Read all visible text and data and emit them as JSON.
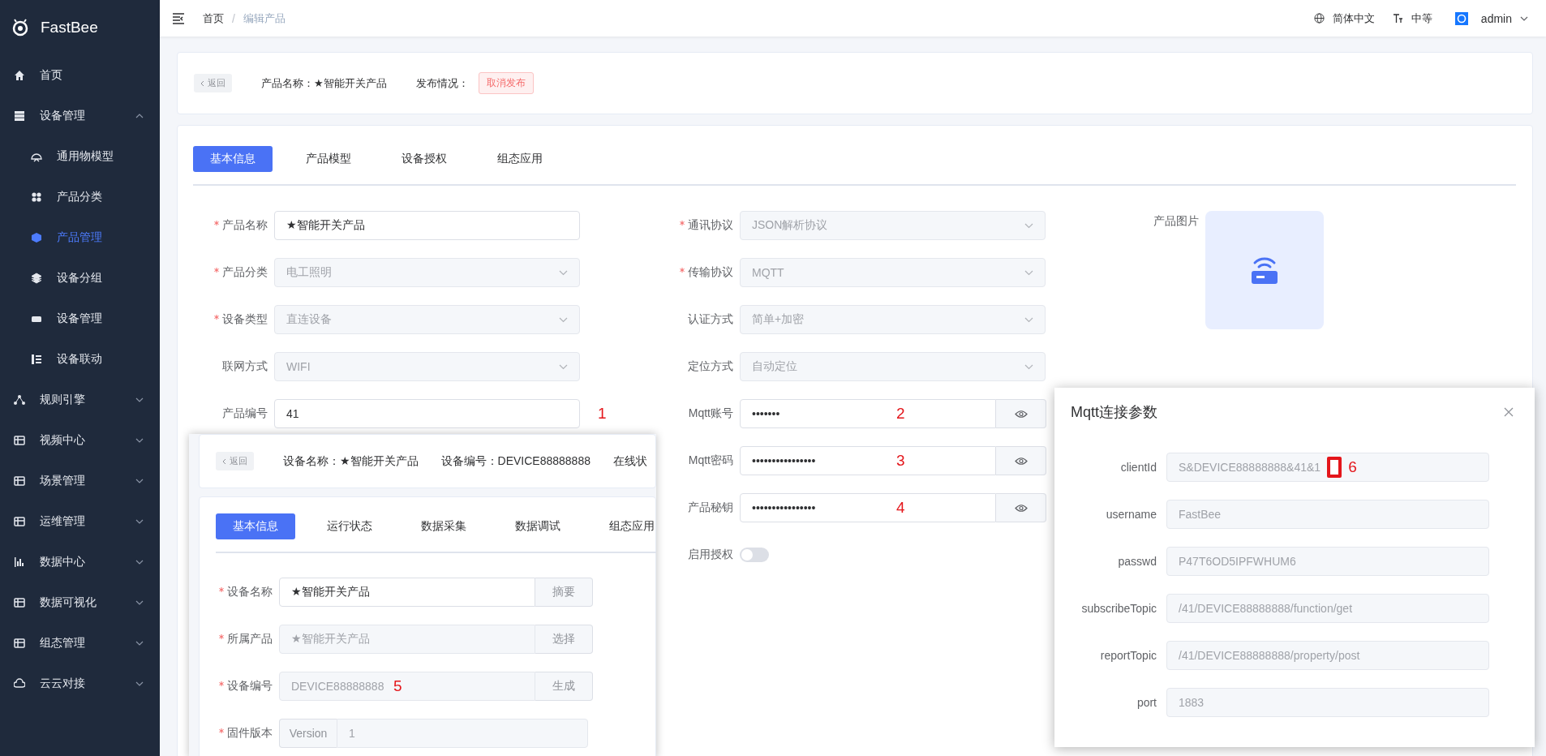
{
  "sidebar": {
    "brand": "FastBee",
    "items": [
      {
        "kind": "link",
        "label": "首页",
        "selected": false
      },
      {
        "kind": "group",
        "label": "设备管理",
        "expanded": true,
        "children": [
          {
            "label": "通用物模型",
            "selected": false
          },
          {
            "label": "产品分类",
            "selected": false
          },
          {
            "label": "产品管理",
            "selected": true
          },
          {
            "label": "设备分组",
            "selected": false
          },
          {
            "label": "设备管理",
            "selected": false
          },
          {
            "label": "设备联动",
            "selected": false
          }
        ]
      },
      {
        "kind": "group",
        "label": "规则引擎",
        "expanded": false
      },
      {
        "kind": "group",
        "label": "视频中心",
        "expanded": false
      },
      {
        "kind": "group",
        "label": "场景管理",
        "expanded": false
      },
      {
        "kind": "group",
        "label": "运维管理",
        "expanded": false
      },
      {
        "kind": "group",
        "label": "数据中心",
        "expanded": false
      },
      {
        "kind": "group",
        "label": "数据可视化",
        "expanded": false
      },
      {
        "kind": "group",
        "label": "组态管理",
        "expanded": false
      },
      {
        "kind": "group",
        "label": "云云对接",
        "expanded": false
      }
    ]
  },
  "header": {
    "breadcrumb": [
      "首页",
      "编辑产品"
    ],
    "separator": "/",
    "language": "简体中文",
    "size": "中等",
    "user": "admin"
  },
  "product_bar": {
    "back": "返回",
    "name": "产品名称：★智能开关产品",
    "status_label": "发布情况：",
    "status_tag": "取消发布"
  },
  "tabs": [
    {
      "label": "基本信息",
      "selected": true
    },
    {
      "label": "产品模型",
      "selected": false
    },
    {
      "label": "设备授权",
      "selected": false
    },
    {
      "label": "组态应用",
      "selected": false
    }
  ],
  "form": {
    "columns": [
      [
        {
          "kind": "input",
          "label": "产品名称",
          "required": true,
          "disabled": false,
          "value": "★智能开关产品"
        },
        {
          "kind": "select",
          "label": "产品分类",
          "required": true,
          "disabled": true,
          "value": "电工照明"
        },
        {
          "kind": "select",
          "label": "设备类型",
          "required": true,
          "disabled": true,
          "value": "直连设备"
        },
        {
          "kind": "select",
          "label": "联网方式",
          "required": false,
          "disabled": true,
          "value": "WIFI"
        },
        {
          "kind": "input",
          "label": "产品编号",
          "required": false,
          "disabled": false,
          "value": "41",
          "annotation": "1"
        }
      ],
      [
        {
          "kind": "select",
          "label": "通讯协议",
          "required": true,
          "disabled": true,
          "value": "JSON解析协议"
        },
        {
          "kind": "select",
          "label": "传输协议",
          "required": true,
          "disabled": true,
          "value": "MQTT"
        },
        {
          "kind": "select",
          "label": "认证方式",
          "required": false,
          "disabled": true,
          "value": "简单+加密"
        },
        {
          "kind": "select",
          "label": "定位方式",
          "required": false,
          "disabled": true,
          "value": "自动定位"
        },
        {
          "kind": "password",
          "label": "Mqtt账号",
          "required": false,
          "disabled": false,
          "value": "•••••••",
          "annotation": "2"
        },
        {
          "kind": "password",
          "label": "Mqtt密码",
          "required": false,
          "disabled": false,
          "value": "••••••••••••••••",
          "annotation": "3"
        },
        {
          "kind": "password",
          "label": "产品秘钥",
          "required": false,
          "disabled": false,
          "value": "••••••••••••••••",
          "annotation": "4"
        },
        {
          "kind": "switch",
          "label": "启用授权",
          "required": false,
          "on": false
        }
      ]
    ],
    "image_label": "产品图片"
  },
  "device_panel": {
    "back": "返回",
    "info": [
      "设备名称：★智能开关产品",
      "设备编号：DEVICE88888888",
      "在线状"
    ],
    "tabs": [
      {
        "label": "基本信息",
        "selected": true
      },
      {
        "label": "运行状态",
        "selected": false
      },
      {
        "label": "数据采集",
        "selected": false
      },
      {
        "label": "数据调试",
        "selected": false
      },
      {
        "label": "组态应用",
        "selected": false
      }
    ],
    "fields": [
      {
        "kind": "append",
        "label": "设备名称",
        "required": true,
        "disabled": false,
        "value": "★智能开关产品",
        "button": "摘要"
      },
      {
        "kind": "append",
        "label": "所属产品",
        "required": true,
        "disabled": true,
        "value": "★智能开关产品",
        "button": "选择"
      },
      {
        "kind": "append",
        "label": "设备编号",
        "required": true,
        "disabled": true,
        "value": "DEVICE88888888",
        "button": "生成",
        "annotation": "5"
      },
      {
        "kind": "prepend",
        "label": "固件版本",
        "required": true,
        "disabled": true,
        "prefix": "Version",
        "value": "1"
      }
    ]
  },
  "dialog": {
    "title": "Mqtt连接参数",
    "fields": [
      {
        "label": "clientId",
        "value": "S&DEVICE88888888&41&1",
        "annotation": "6"
      },
      {
        "label": "username",
        "value": "FastBee"
      },
      {
        "label": "passwd",
        "value": "P47T6OD5IPFWHUM6"
      },
      {
        "label": "subscribeTopic",
        "value": "/41/DEVICE88888888/function/get"
      },
      {
        "label": "reportTopic",
        "value": "/41/DEVICE88888888/property/post"
      },
      {
        "label": "port",
        "value": "1883"
      }
    ]
  }
}
